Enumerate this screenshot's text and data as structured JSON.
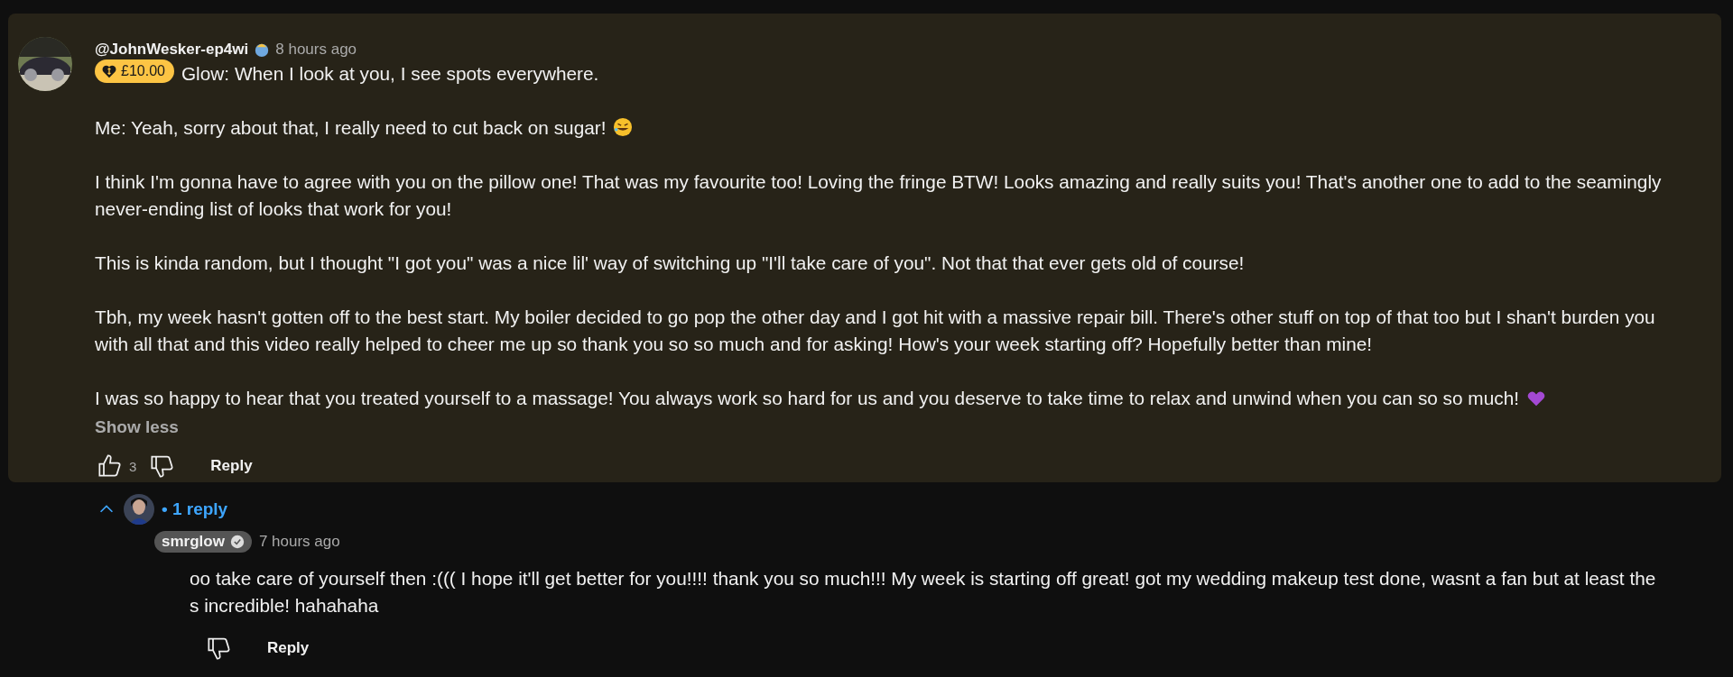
{
  "comment": {
    "author": "@JohnWesker-ep4wi",
    "time": "8 hours ago",
    "donation": "£10.00",
    "paragraphs": [
      {
        "lines": [
          "Glow: When I look at you, I see spots everywhere."
        ]
      },
      {
        "lines": [
          "Me: Yeah, sorry about that, I really need to cut back on sugar!"
        ],
        "laughing_emoji": true
      },
      {
        "lines": [
          "I think I'm gonna have to agree with you on the pillow one! That was my favourite too! Loving the fringe BTW! Looks amazing and really suits you! That's another one to add to the seamingly",
          "never-ending list of looks that work for you!"
        ]
      },
      {
        "lines": [
          "This is kinda random, but I thought \"I got you\" was a nice lil' way of switching up \"I'll take care of you\". Not that that ever gets old of course!"
        ]
      },
      {
        "lines": [
          "Tbh, my week hasn't gotten off to the best start. My boiler decided to go pop the other day and I got hit with a massive repair bill. There's other stuff on top of that too but I shan't burden you",
          "with all that and this video really helped to cheer me up so thank you so so much and for asking! How's your week starting off? Hopefully better than mine!"
        ]
      },
      {
        "lines": [
          "I was so happy to hear that you treated yourself to a massage! You always work so hard for us and you deserve to take time to relax and unwind when you can so so much!"
        ],
        "heart_emoji": true
      }
    ],
    "show_less": "Show less",
    "likes": "3",
    "reply_button": "Reply"
  },
  "replies_toggle": {
    "label": "• 1 reply",
    "expanded": true
  },
  "reply": {
    "author": "smrglow",
    "time": "7 hours ago",
    "lines": [
      "oo take care of yourself then :((( I hope it'll get better for you!!!! thank you so much!!! My week is starting off great! got my wedding makeup test done, wasnt a fan but at least the",
      "s incredible! hahahaha"
    ],
    "reply_button": "Reply"
  }
}
